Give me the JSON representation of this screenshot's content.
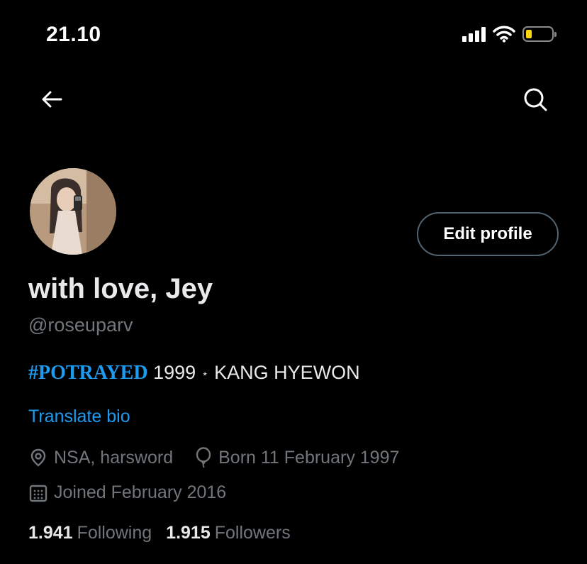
{
  "status_bar": {
    "time": "21.10",
    "icons": [
      "signal-icon",
      "wifi-icon",
      "battery-icon"
    ],
    "battery_color": "#ffd60a"
  },
  "nav": {
    "back_icon": "back-arrow-icon",
    "search_icon": "search-icon"
  },
  "profile": {
    "display_name": "with love, Jey",
    "handle": "@roseuparv",
    "edit_label": "Edit profile",
    "bio": {
      "hashtag": "#POTRAYED",
      "text_before_star": "1999",
      "star": "⋆",
      "text_after_star": "KANG HYEWON"
    },
    "translate_label": "Translate bio",
    "location": "NSA, harsword",
    "birthday": "Born 11 February 1997",
    "joined": "Joined February 2016",
    "following_count": "1.941",
    "following_label": "Following",
    "followers_count": "1.915",
    "followers_label": "Followers"
  },
  "colors": {
    "background": "#000000",
    "accent": "#1d9bf0",
    "secondary_text": "#71767b",
    "primary_text": "#e7e9ea"
  }
}
